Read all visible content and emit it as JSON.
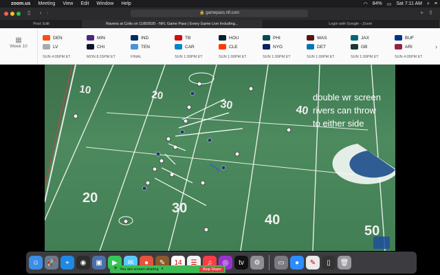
{
  "menubar": {
    "app": "zoom.us",
    "items": [
      "Meeting",
      "View",
      "Edit",
      "Window",
      "Help"
    ],
    "battery": "84%",
    "clock": "Sat 7:11 AM"
  },
  "browser": {
    "address": "gamepass.nfl.com",
    "tabs": [
      "Post: Edit",
      "Ravens at Colts on 11/8/2020 - NFL Game Pass | Every Game Live Including...",
      "Login with Google - Zoom"
    ]
  },
  "schedule": {
    "week_label": "Week 10",
    "games": [
      {
        "t1": "DEN",
        "t2": "LV",
        "c1": "#fb4f14",
        "c2": "#a5acaf",
        "time": "SUN 4:05PM ET"
      },
      {
        "t1": "MIN",
        "t2": "CHI",
        "c1": "#4f2683",
        "c2": "#0b162a",
        "time": "MON 8:15PM ET"
      },
      {
        "t1": "IND",
        "t2": "TEN",
        "c1": "#002c5f",
        "c2": "#4b92db",
        "time": "FINAL"
      },
      {
        "t1": "TB",
        "t2": "CAR",
        "c1": "#d50a0a",
        "c2": "#0085ca",
        "time": "SUN 1:00PM ET"
      },
      {
        "t1": "HOU",
        "t2": "CLE",
        "c1": "#03202f",
        "c2": "#ff3c00",
        "time": "SUN 1:00PM ET"
      },
      {
        "t1": "PHI",
        "t2": "NYG",
        "c1": "#004c54",
        "c2": "#0b2265",
        "time": "SUN 1:00PM ET"
      },
      {
        "t1": "WAS",
        "t2": "DET",
        "c1": "#5a1414",
        "c2": "#0076b6",
        "time": "SUN 1:00PM ET"
      },
      {
        "t1": "JAX",
        "t2": "GB",
        "c1": "#006778",
        "c2": "#203731",
        "time": "SUN 1:00PM ET"
      },
      {
        "t1": "BUF",
        "t2": "ARI",
        "c1": "#00338d",
        "c2": "#97233f",
        "time": "SUN 4:05PM ET"
      }
    ]
  },
  "video": {
    "overlay_lines": [
      "double wr screen",
      "rivers can throw",
      "to either side"
    ],
    "yard_numbers": [
      "10",
      "20",
      "30",
      "40",
      "50",
      "20",
      "30",
      "40"
    ]
  },
  "dock": {
    "apps": [
      {
        "name": "finder",
        "color": "#3a8ee6",
        "glyph": "☺"
      },
      {
        "name": "launchpad",
        "color": "#6b7a8a",
        "glyph": "🚀"
      },
      {
        "name": "safari",
        "color": "#1e88e5",
        "glyph": "⌖"
      },
      {
        "name": "photos",
        "color": "#2c2c2c",
        "glyph": "◉"
      },
      {
        "name": "preview",
        "color": "#4c6fa8",
        "glyph": "▣"
      },
      {
        "name": "facetime",
        "color": "#34c759",
        "glyph": "▶"
      },
      {
        "name": "messages",
        "color": "#5ac8fa",
        "glyph": "✉"
      },
      {
        "name": "chrome",
        "color": "#e5533d",
        "glyph": "●"
      },
      {
        "name": "notes",
        "color": "#8b5a2b",
        "glyph": "✎"
      },
      {
        "name": "calendar",
        "color": "#ffffff",
        "glyph": "14"
      },
      {
        "name": "reminders",
        "color": "#f2f2f2",
        "glyph": "☰"
      },
      {
        "name": "music",
        "color": "#fc3c44",
        "glyph": "♫"
      },
      {
        "name": "podcasts",
        "color": "#9933cc",
        "glyph": "◎"
      },
      {
        "name": "tv",
        "color": "#111111",
        "glyph": "tv"
      },
      {
        "name": "system-prefs",
        "color": "#8e8e93",
        "glyph": "⚙"
      }
    ],
    "apps_right": [
      {
        "name": "image-capture",
        "color": "#7a7a80",
        "glyph": "▭"
      },
      {
        "name": "zoom",
        "color": "#2d8cff",
        "glyph": "●"
      },
      {
        "name": "textedit",
        "color": "#eaeaea",
        "glyph": "✎"
      },
      {
        "name": "screenshots",
        "color": "#333333",
        "glyph": "▯"
      },
      {
        "name": "trash",
        "color": "#9a9a9e",
        "glyph": "🗑"
      }
    ]
  },
  "screen_share": {
    "message": "You are screen sharing",
    "stop_label": "Stop Share"
  }
}
